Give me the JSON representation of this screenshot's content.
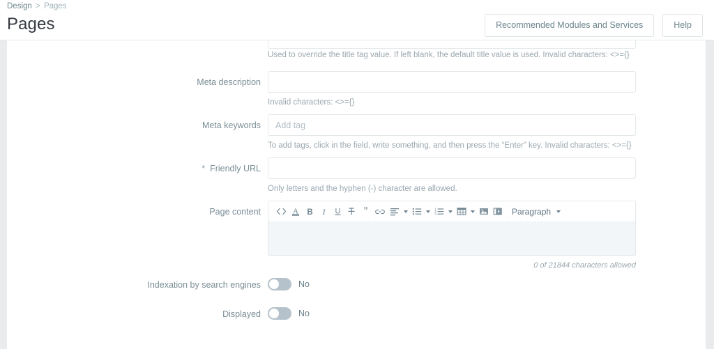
{
  "header": {
    "breadcrumb": {
      "root": "Design",
      "separator": ">",
      "current": "Pages"
    },
    "title": "Pages",
    "actions": {
      "recommended_modules": "Recommended Modules and Services",
      "help": "Help"
    }
  },
  "form": {
    "meta_title_hint": "Used to override the title tag value. If left blank, the default title value is used. Invalid characters: <>={}",
    "rows": {
      "meta_description": {
        "label": "Meta description",
        "value": "",
        "placeholder": "",
        "hint": "Invalid characters: <>={}"
      },
      "meta_keywords": {
        "label": "Meta keywords",
        "value": "",
        "placeholder": "Add tag",
        "hint": "To add tags, click in the field, write something, and then press the “Enter” key. Invalid characters: <>={}"
      },
      "friendly_url": {
        "label": "Friendly URL",
        "required_marker": "*",
        "value": "",
        "placeholder": "",
        "hint": "Only letters and the hyphen (-) character are allowed."
      },
      "page_content": {
        "label": "Page content",
        "value": "",
        "counter": "0 of 21844 characters allowed",
        "toolbar": {
          "source_code": "Source code",
          "text_color": "Text color",
          "bold": "Bold",
          "italic": "Italic",
          "underline": "Underline",
          "strikethrough": "Strikethrough",
          "blockquote": "Blockquote",
          "link": "Insert link",
          "align": "Align",
          "unordered_list": "Unordered list",
          "ordered_list": "Ordered list",
          "table": "Table",
          "image": "Insert image",
          "video": "Insert video",
          "format_block": "Paragraph"
        }
      },
      "indexation": {
        "label": "Indexation by search engines",
        "state_label": "No",
        "enabled": false
      },
      "displayed": {
        "label": "Displayed",
        "state_label": "No",
        "enabled": false
      }
    }
  },
  "colors": {
    "page_background": "#e9ebed",
    "panel": "#ffffff",
    "label_text": "#7a8d96",
    "hint_text": "#9aa8b0",
    "border": "#e3e8eb",
    "toggle_off_track": "#b6c2cb",
    "editor_body": "#f3f6f8",
    "title_text": "#363a41"
  }
}
